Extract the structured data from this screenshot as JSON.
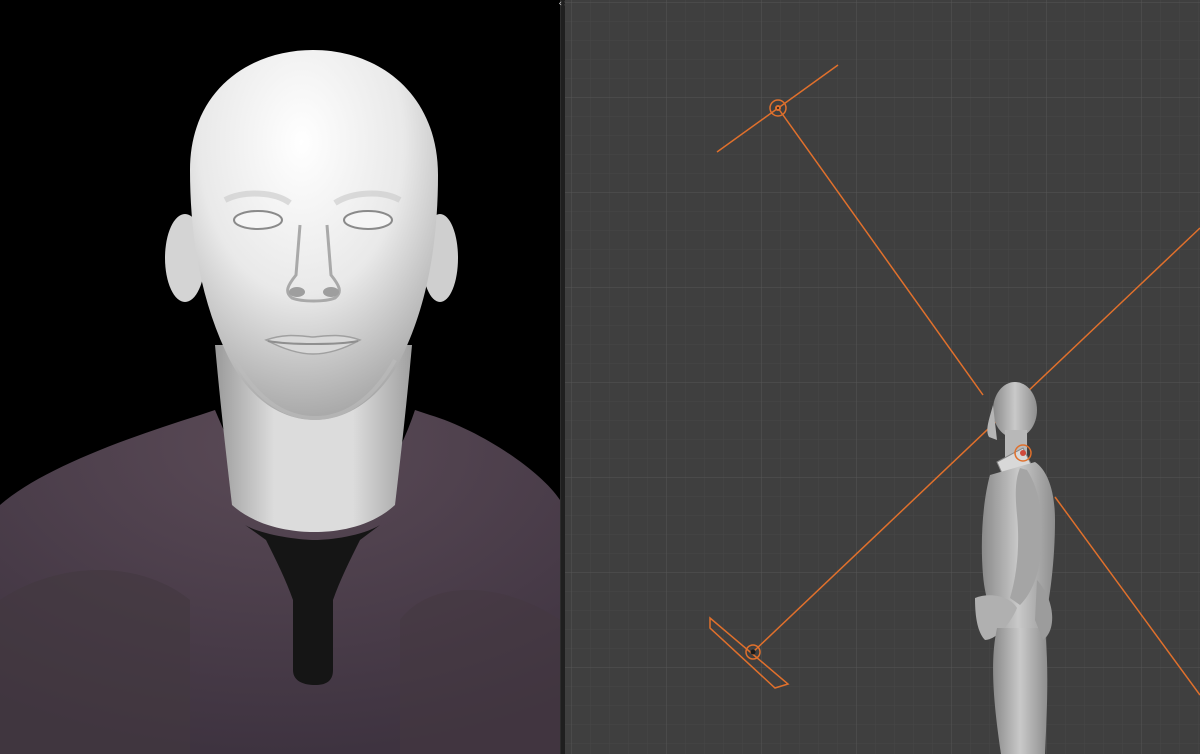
{
  "panels": {
    "left": {
      "name": "render-preview"
    },
    "right": {
      "name": "3d-viewport"
    }
  },
  "splitter": {
    "icon": "resize-arrows-icon",
    "glyph": "‹›"
  },
  "colors": {
    "render_bg": "#000000",
    "viewport_bg": "#3f3f3f",
    "grid_minor": "#474747",
    "grid_major": "#525252",
    "light_line": "#e0702c",
    "shirt": "#4a3c47",
    "skin": "#e4e4e4",
    "undershirt": "#151515"
  },
  "objects": [
    {
      "name": "spot-light-top",
      "icon": "light-icon"
    },
    {
      "name": "area-light-bottom",
      "icon": "light-icon"
    },
    {
      "name": "human-figure-side",
      "icon": "mesh-icon"
    }
  ]
}
